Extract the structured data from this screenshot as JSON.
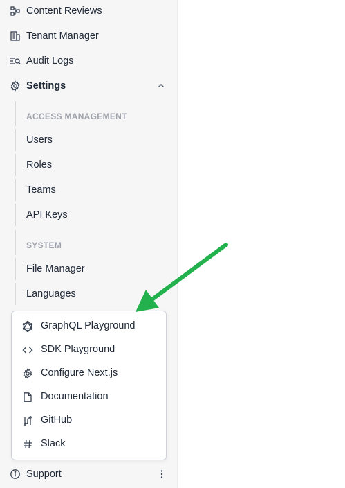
{
  "nav": {
    "content_reviews": "Content Reviews",
    "tenant_manager": "Tenant Manager",
    "audit_logs": "Audit Logs",
    "settings": "Settings"
  },
  "settings": {
    "access_header": "ACCESS MANAGEMENT",
    "users": "Users",
    "roles": "Roles",
    "teams": "Teams",
    "api_keys": "API Keys",
    "system_header": "SYSTEM",
    "file_manager": "File Manager",
    "languages": "Languages"
  },
  "popup": {
    "items": [
      {
        "label": "GraphQL Playground",
        "icon": "graphql-icon"
      },
      {
        "label": "SDK Playground",
        "icon": "code-icon"
      },
      {
        "label": "Configure Next.js",
        "icon": "gear-icon"
      },
      {
        "label": "Documentation",
        "icon": "document-icon"
      },
      {
        "label": "GitHub",
        "icon": "github-icon"
      },
      {
        "label": "Slack",
        "icon": "hash-icon"
      }
    ]
  },
  "support": {
    "label": "Support"
  },
  "colors": {
    "arrow": "#22b14c",
    "sidebar_bg": "#f6f6f7",
    "muted": "#a0a3ab"
  }
}
